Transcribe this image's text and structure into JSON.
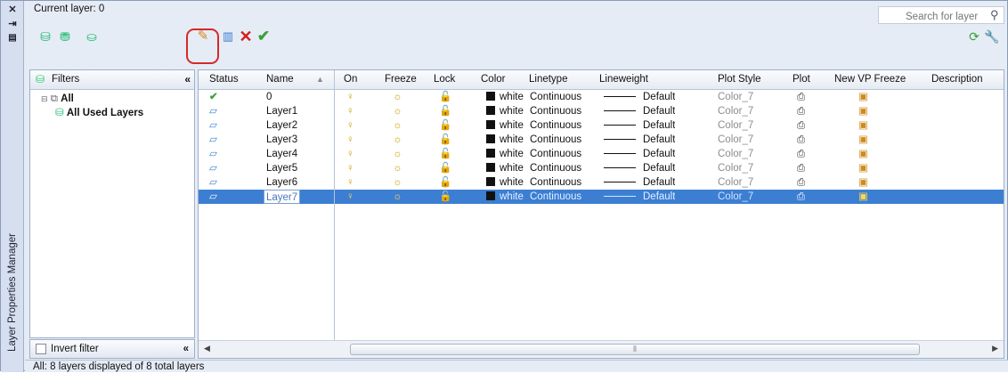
{
  "panel": {
    "title": "Layer Properties Manager",
    "current_layer": "Current layer: 0"
  },
  "search": {
    "placeholder": "Search for layer"
  },
  "filters": {
    "title": "Filters",
    "tree": [
      "All",
      "All Used Layers"
    ],
    "invert": "Invert filter"
  },
  "columns": {
    "status": "Status",
    "name": "Name",
    "on": "On",
    "freeze": "Freeze",
    "lock": "Lock",
    "color": "Color",
    "linetype": "Linetype",
    "lineweight": "Lineweight",
    "plotstyle": "Plot Style",
    "plot": "Plot",
    "vpfreeze": "New VP Freeze",
    "description": "Description"
  },
  "layers": [
    {
      "status": "current",
      "name": "0",
      "color": "white",
      "linetype": "Continuous",
      "lineweight": "Default",
      "plotstyle": "Color_7"
    },
    {
      "status": "layer",
      "name": "Layer1",
      "color": "white",
      "linetype": "Continuous",
      "lineweight": "Default",
      "plotstyle": "Color_7"
    },
    {
      "status": "layer",
      "name": "Layer2",
      "color": "white",
      "linetype": "Continuous",
      "lineweight": "Default",
      "plotstyle": "Color_7"
    },
    {
      "status": "layer",
      "name": "Layer3",
      "color": "white",
      "linetype": "Continuous",
      "lineweight": "Default",
      "plotstyle": "Color_7"
    },
    {
      "status": "layer",
      "name": "Layer4",
      "color": "white",
      "linetype": "Continuous",
      "lineweight": "Default",
      "plotstyle": "Color_7"
    },
    {
      "status": "layer",
      "name": "Layer5",
      "color": "white",
      "linetype": "Continuous",
      "lineweight": "Default",
      "plotstyle": "Color_7"
    },
    {
      "status": "layer",
      "name": "Layer6",
      "color": "white",
      "linetype": "Continuous",
      "lineweight": "Default",
      "plotstyle": "Color_7"
    },
    {
      "status": "layer",
      "name": "Layer7",
      "color": "white",
      "linetype": "Continuous",
      "lineweight": "Default",
      "plotstyle": "Color_7",
      "selected": true
    }
  ],
  "status_bar": "All: 8 layers displayed of 8 total layers",
  "colors": {
    "selection": "#3c7fd2",
    "highlight_box": "#d42a2a",
    "current_check": "#3aa03a",
    "delete_x": "#d32020"
  },
  "icons": [
    "close-icon",
    "auto-hide-icon",
    "properties-icon",
    "new-property-filter-icon",
    "new-group-filter-icon",
    "layer-states-icon",
    "new-layer-icon",
    "new-vp-frozen-layer-icon",
    "delete-layer-icon",
    "set-current-icon",
    "search-icon",
    "refresh-icon",
    "settings-icon",
    "lightbulb-icon",
    "sun-icon",
    "unlock-icon",
    "printer-icon",
    "vp-freeze-icon",
    "layer-sheet-icon",
    "checkmark-icon"
  ]
}
